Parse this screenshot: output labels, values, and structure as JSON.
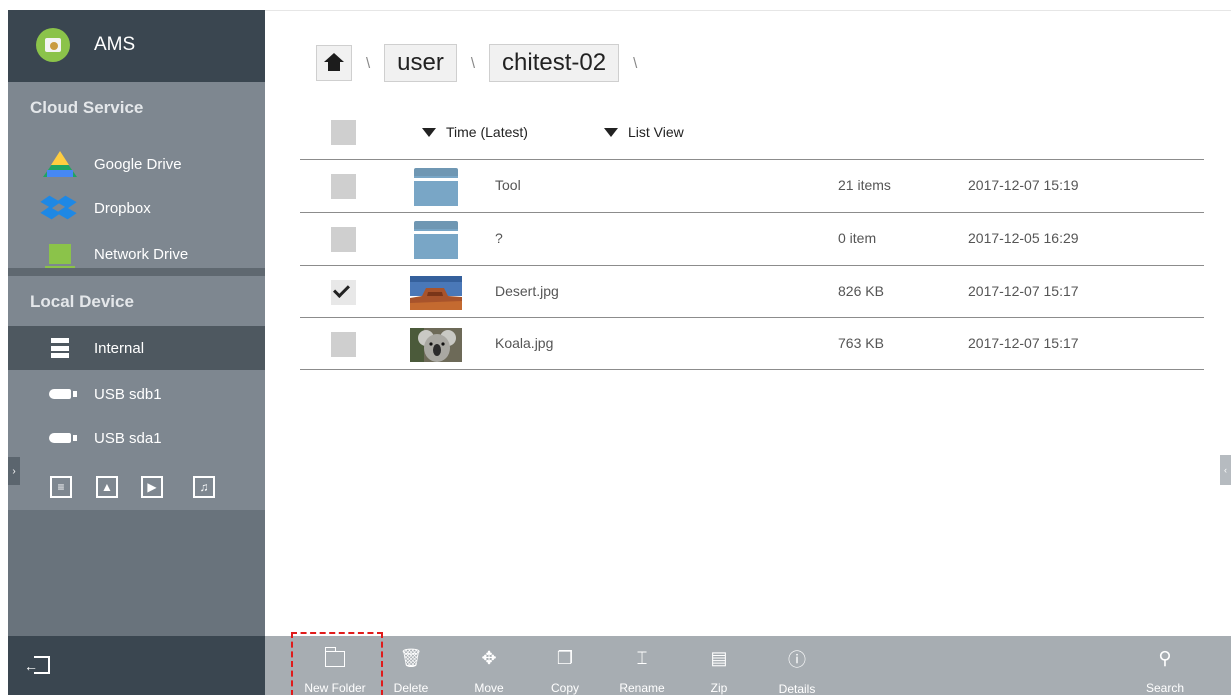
{
  "app": {
    "title": "AMS",
    "logo_color": "#8bc34a"
  },
  "sidebar": {
    "cloud_title": "Cloud Service",
    "cloud_items": [
      {
        "label": "Google Drive",
        "icon": "google-drive-icon"
      },
      {
        "label": "Dropbox",
        "icon": "dropbox-icon"
      },
      {
        "label": "Network Drive",
        "icon": "network-drive-icon"
      }
    ],
    "local_title": "Local Device",
    "local_items": [
      {
        "label": "Internal",
        "icon": "server-icon",
        "selected": true
      },
      {
        "label": "USB sdb1",
        "icon": "usb-icon"
      },
      {
        "label": "USB sda1",
        "icon": "usb-icon"
      }
    ],
    "media_filters": [
      "document-icon",
      "image-icon",
      "video-icon",
      "music-icon"
    ]
  },
  "breadcrumb": {
    "home_icon": "home-icon",
    "separator": "\\",
    "items": [
      "user",
      "chitest-02"
    ]
  },
  "list": {
    "sort_label": "Time (Latest)",
    "view_label": "List View",
    "rows": [
      {
        "name": "Tool",
        "size": "21 items",
        "date": "2017-12-07 15:19",
        "type": "folder",
        "checked": false
      },
      {
        "name": "?",
        "size": "0 item",
        "date": "2017-12-05 16:29",
        "type": "folder",
        "checked": false
      },
      {
        "name": "Desert.jpg",
        "size": "826 KB",
        "date": "2017-12-07 15:17",
        "type": "image",
        "checked": true
      },
      {
        "name": "Koala.jpg",
        "size": "763 KB",
        "date": "2017-12-07 15:17",
        "type": "image",
        "checked": false
      }
    ]
  },
  "toolbar": {
    "new_folder": "New Folder",
    "delete": "Delete",
    "move": "Move",
    "copy": "Copy",
    "rename": "Rename",
    "zip": "Zip",
    "details": "Details",
    "search": "Search"
  },
  "colors": {
    "sidebar_dark": "#3a4650",
    "sidebar_panel": "#7e8790",
    "toolbar": "#a7adb2",
    "folder": "#79a6c6",
    "highlight": "#e01b1b"
  }
}
